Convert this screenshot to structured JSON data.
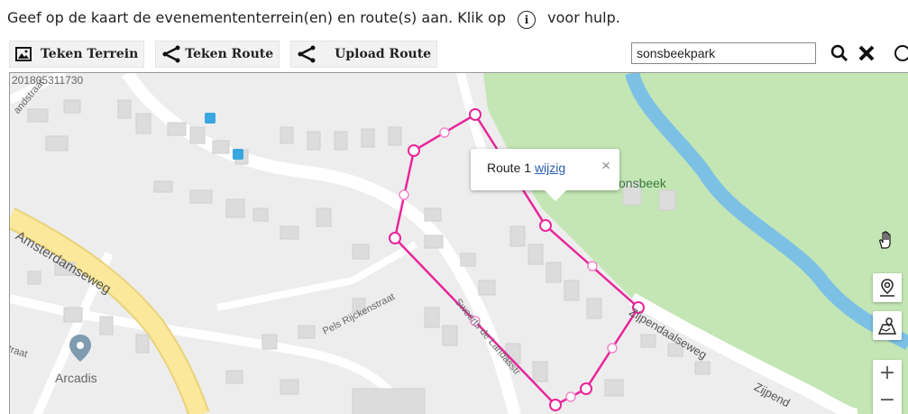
{
  "instruction": {
    "before": "Geef op de kaart de evenemententerrein(en) en route(s) aan. Klik op",
    "after": "voor hulp.",
    "info_symbol": "i"
  },
  "toolbar": {
    "draw_area_label": "Teken Terrein",
    "draw_route_label": "Teken Route",
    "upload_route_label": "Upload Route"
  },
  "search": {
    "value": "sonsbeekpark"
  },
  "map": {
    "id_label": "201805311730",
    "streets": {
      "amsterdamseweg": "Amsterdamseweg",
      "pels": "Pels Rijckenstraat",
      "sweerts": "Sweerts de Landasstr",
      "zijpendaal": "Zijpendaalseweg",
      "zijpend2": "Zijpend",
      "landstraat": "andstraat",
      "traat": "traat"
    },
    "places": {
      "arcadis": "Arcadis",
      "sonsbeek": "onsbeek"
    },
    "popup": {
      "title": "Route 1",
      "link": "wijzig",
      "close": "×"
    },
    "zoom": {
      "in": "+",
      "out": "−"
    }
  },
  "colors": {
    "route": "#e8259a",
    "park": "#c3e6b4",
    "water": "#7cc0e6",
    "road_major": "#fbe89a"
  }
}
